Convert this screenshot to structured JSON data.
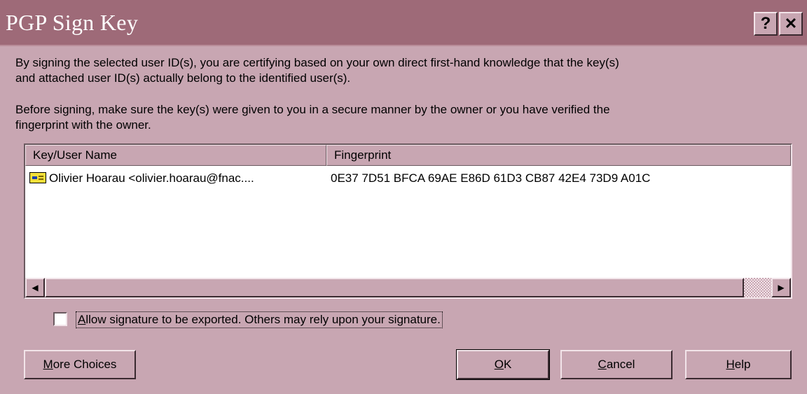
{
  "window": {
    "title": "PGP Sign Key",
    "help_glyph": "?",
    "close_glyph": "✕"
  },
  "body": {
    "paragraph1_line1": "By signing the selected user ID(s), you are certifying based on your own direct first-hand knowledge that the key(s)",
    "paragraph1_line2": "and attached user ID(s) actually belong to the identified user(s).",
    "paragraph2_line1": "Before signing, make sure the key(s) were given to you in a secure manner by the owner or you have verified the",
    "paragraph2_line2": "fingerprint with the owner."
  },
  "keylist": {
    "columns": [
      "Key/User Name",
      "Fingerprint"
    ],
    "rows": [
      {
        "icon": "key-icon",
        "name": "Olivier Hoarau <olivier.hoarau@fnac....",
        "fingerprint": "0E37 7D51 BFCA 69AE E86D  61D3 CB87 42E4 73D9 A01C"
      }
    ],
    "scroll_left_glyph": "◀",
    "scroll_right_glyph": "▶"
  },
  "options": {
    "allow_export": {
      "checked": false,
      "label_mnemonic": "A",
      "label_rest": "llow signature to be exported.  Others may rely upon your signature."
    }
  },
  "buttons": {
    "more_choices": {
      "mnemonic": "M",
      "rest": "ore Choices"
    },
    "ok": {
      "mnemonic": "O",
      "rest": "K"
    },
    "cancel": {
      "mnemonic": "C",
      "rest": "ancel"
    },
    "help": {
      "mnemonic": "H",
      "rest": "elp"
    }
  },
  "colors": {
    "face": "#c8a6b2",
    "titlebar": "#9e6a78",
    "highlight": "#f2e4e9",
    "shadow": "#3a2a30"
  }
}
